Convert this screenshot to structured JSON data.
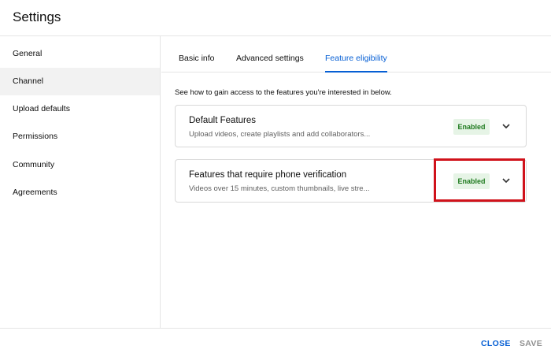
{
  "header": {
    "title": "Settings"
  },
  "sidebar": {
    "items": [
      {
        "label": "General"
      },
      {
        "label": "Channel"
      },
      {
        "label": "Upload defaults"
      },
      {
        "label": "Permissions"
      },
      {
        "label": "Community"
      },
      {
        "label": "Agreements"
      }
    ]
  },
  "tabs": [
    {
      "label": "Basic info"
    },
    {
      "label": "Advanced settings"
    },
    {
      "label": "Feature eligibility"
    }
  ],
  "main": {
    "intro": "See how to gain access to the features you're interested in below.",
    "cards": [
      {
        "title": "Default Features",
        "description": "Upload videos, create playlists and add collaborators...",
        "status": "Enabled",
        "icon": "chevron-down-icon"
      },
      {
        "title": "Features that require phone verification",
        "description": "Videos over 15 minutes, custom thumbnails, live stre...",
        "status": "Enabled",
        "icon": "chevron-down-icon"
      }
    ]
  },
  "footer": {
    "close_label": "CLOSE",
    "save_label": "SAVE"
  },
  "colors": {
    "accent": "#065fd4",
    "badge_bg": "#e6f4e6",
    "badge_text": "#1e7a1e",
    "highlight": "#d0121b"
  }
}
